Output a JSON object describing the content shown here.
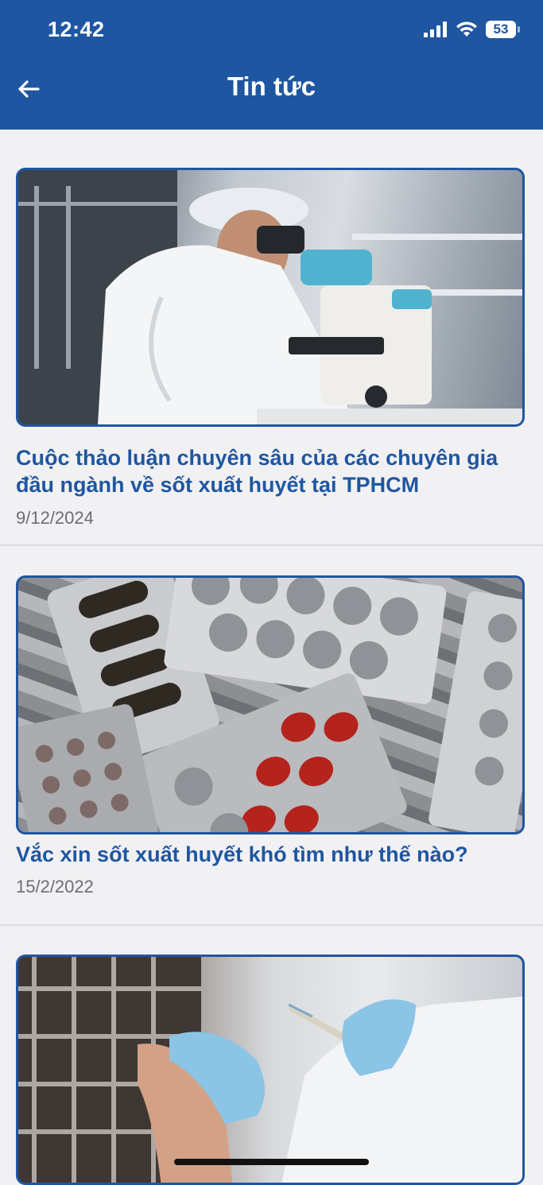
{
  "status_bar": {
    "time": "12:42",
    "battery": "53"
  },
  "header": {
    "title": "Tin tức",
    "back_icon": "arrow-left-icon"
  },
  "news": [
    {
      "title": "Cuộc thảo luận chuyên sâu của các chuyên gia đầu ngành về sốt xuất huyết tại TPHCM",
      "date": "9/12/2024"
    },
    {
      "title": "Vắc xin sốt xuất huyết khó tìm như thế nào?",
      "date": "15/2/2022"
    },
    {
      "title": "",
      "date": ""
    }
  ],
  "colors": {
    "header_bg": "#1f56a1",
    "accent": "#1f56a1",
    "date_text": "#6d6d72",
    "page_bg": "#f1f1f3"
  }
}
